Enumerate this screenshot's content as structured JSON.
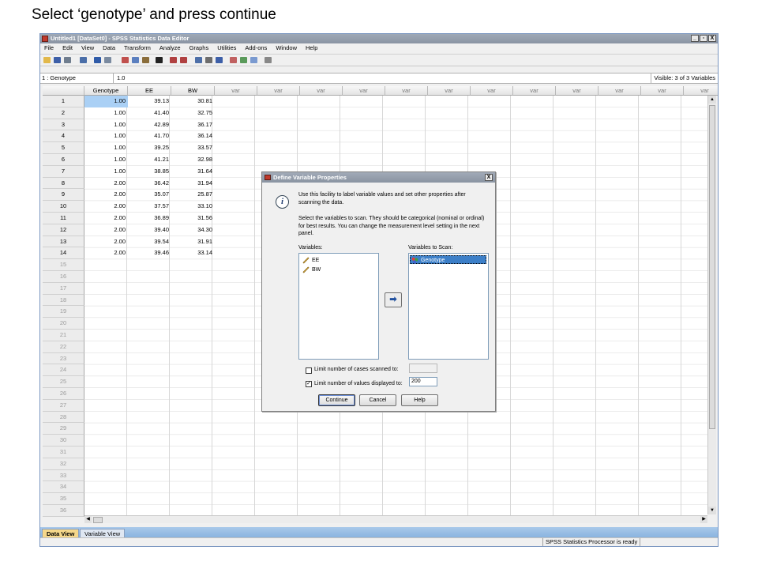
{
  "caption": "Select ‘genotype’ and press continue",
  "window": {
    "title": "Untitled1 [DataSet0] - SPSS Statistics Data Editor",
    "controls": [
      "_",
      "▫",
      "X"
    ]
  },
  "menu": [
    "File",
    "Edit",
    "View",
    "Data",
    "Transform",
    "Analyze",
    "Graphs",
    "Utilities",
    "Add-ons",
    "Window",
    "Help"
  ],
  "cell_editor": {
    "cell_name": "1 : Genotype",
    "cell_value": "1.0",
    "visible": "Visible: 3 of 3 Variables"
  },
  "columns": [
    "Genotype",
    "EE",
    "BW",
    "var",
    "var",
    "var",
    "var",
    "var",
    "var",
    "var",
    "var",
    "var",
    "var",
    "var",
    "var"
  ],
  "row_numbers": [
    "1",
    "2",
    "3",
    "4",
    "5",
    "6",
    "7",
    "8",
    "9",
    "10",
    "11",
    "12",
    "13",
    "14",
    "15",
    "16",
    "17",
    "18",
    "19",
    "20",
    "21",
    "22",
    "23",
    "24",
    "25",
    "26",
    "27",
    "28",
    "29",
    "30",
    "31",
    "32",
    "33",
    "34",
    "35",
    "36"
  ],
  "rows": [
    [
      "1.00",
      "39.13",
      "30.81"
    ],
    [
      "1.00",
      "41.40",
      "32.75"
    ],
    [
      "1.00",
      "42.89",
      "36.17"
    ],
    [
      "1.00",
      "41.70",
      "36.14"
    ],
    [
      "1.00",
      "39.25",
      "33.57"
    ],
    [
      "1.00",
      "41.21",
      "32.98"
    ],
    [
      "1.00",
      "38.85",
      "31.64"
    ],
    [
      "2.00",
      "36.42",
      "31.94"
    ],
    [
      "2.00",
      "35.07",
      "25.87"
    ],
    [
      "2.00",
      "37.57",
      "33.10"
    ],
    [
      "2.00",
      "36.89",
      "31.56"
    ],
    [
      "2.00",
      "39.40",
      "34.30"
    ],
    [
      "2.00",
      "39.54",
      "31.91"
    ],
    [
      "2.00",
      "39.46",
      "33.14"
    ]
  ],
  "tabs": {
    "data_view": "Data View",
    "variable_view": "Variable View"
  },
  "status": "SPSS Statistics  Processor is ready",
  "dialog": {
    "title": "Define Variable Properties",
    "close": "X",
    "text1": "Use this facility to label variable values and set other properties after scanning the data.",
    "text2": "Select the variables to scan. They should be categorical (nominal or ordinal) for best results. You can change the measurement level setting in the next panel.",
    "variables_label": "Variables:",
    "variables": [
      "EE",
      "BW"
    ],
    "scan_label": "Variables to Scan:",
    "scan_vars": [
      "Genotype"
    ],
    "limit_cases_label": "Limit number of cases scanned to:",
    "limit_cases_checked": false,
    "limit_cases_value": "",
    "limit_values_label": "Limit number of values displayed to:",
    "limit_values_checked": true,
    "limit_values_value": "200",
    "buttons": {
      "continue": "Continue",
      "cancel": "Cancel",
      "help": "Help"
    }
  }
}
